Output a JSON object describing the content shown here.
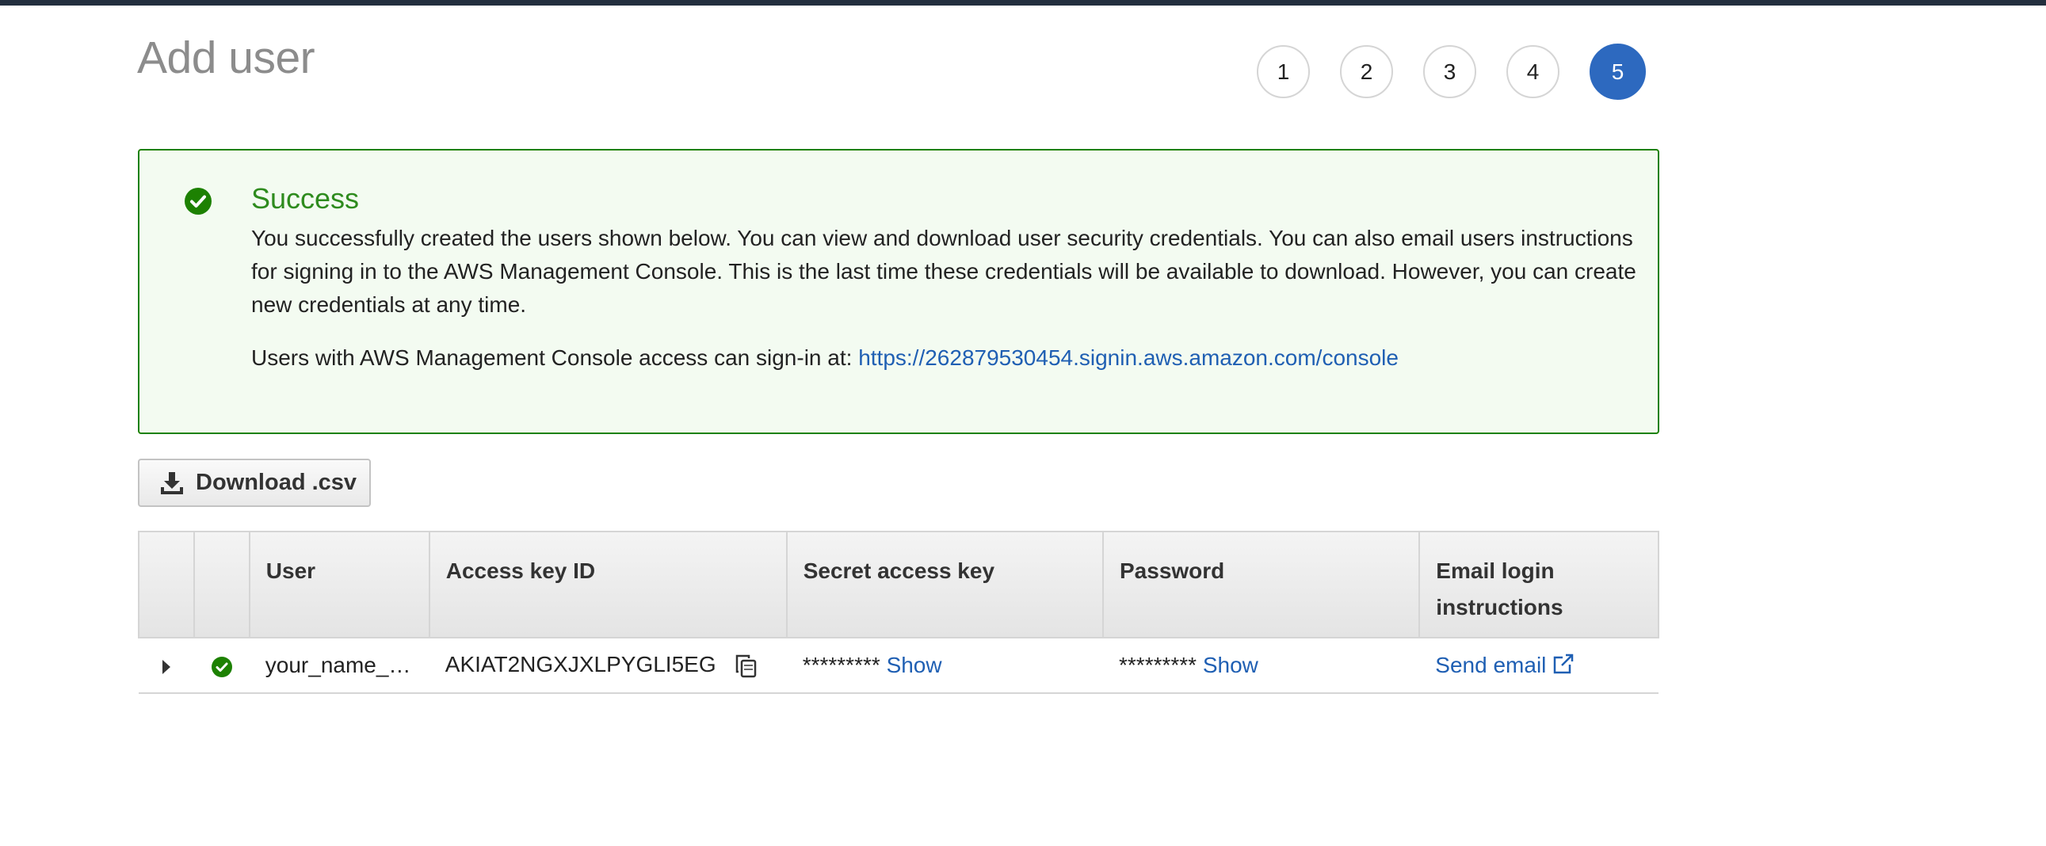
{
  "page": {
    "title": "Add user"
  },
  "wizard": {
    "steps": [
      {
        "label": "1",
        "active": false
      },
      {
        "label": "2",
        "active": false
      },
      {
        "label": "3",
        "active": false
      },
      {
        "label": "4",
        "active": false
      },
      {
        "label": "5",
        "active": true
      }
    ]
  },
  "alert": {
    "title": "Success",
    "body": "You successfully created the users shown below. You can view and download user security credentials. You can also email users instructions for signing in to the AWS Management Console. This is the last time these credentials will be available to download. However, you can create new credentials at any time.",
    "signin_prefix": "Users with AWS Management Console access can sign-in at: ",
    "signin_url": "https://262879530454.signin.aws.amazon.com/console",
    "icon": "check-circle-icon",
    "color": "#1d8102"
  },
  "toolbar": {
    "download_label": "Download .csv",
    "download_icon": "download-icon"
  },
  "table": {
    "headers": {
      "user": "User",
      "access_key_id": "Access key ID",
      "secret_access_key": "Secret access key",
      "password": "Password",
      "email_login": "Email login instructions"
    },
    "rows": [
      {
        "user": "your_name_…",
        "access_key_id": "AKIAT2NGXJXLPYGLI5EG",
        "secret_masked": "*********",
        "secret_show": "Show",
        "password_masked": "*********",
        "password_show": "Show",
        "email_action": "Send email"
      }
    ]
  },
  "colors": {
    "accent": "#2d69bf",
    "link": "#1f5fb3",
    "success": "#1d8102",
    "topbar": "#232f3e"
  }
}
